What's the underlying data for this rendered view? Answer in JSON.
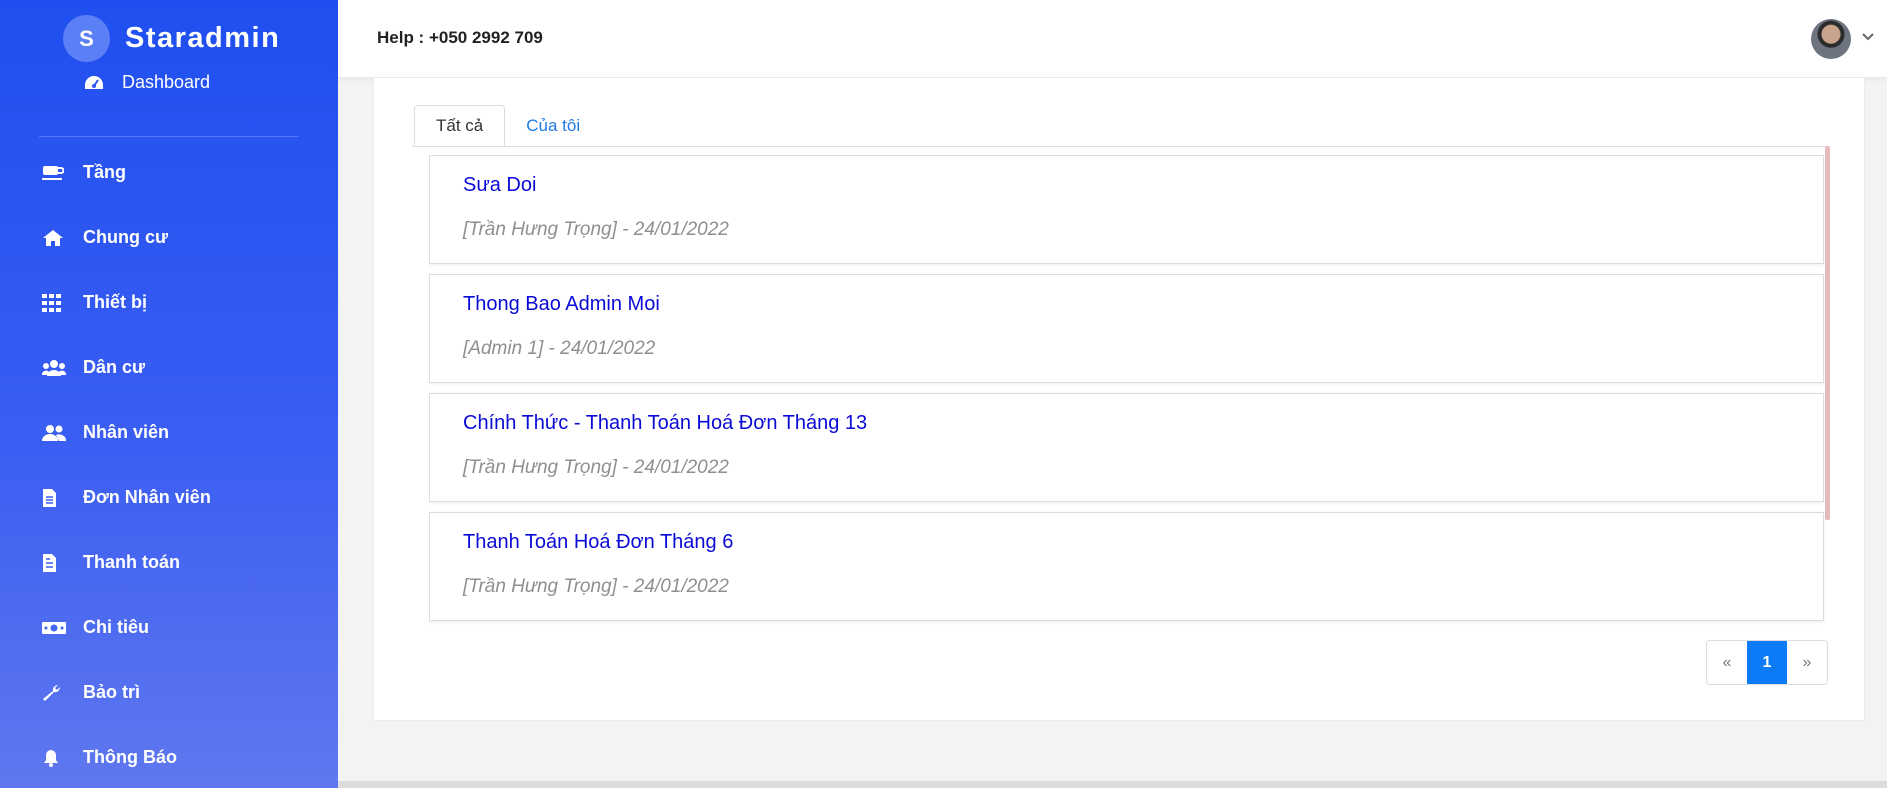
{
  "sidebar": {
    "brand_initial": "S",
    "brand_name": "Staradmin",
    "dashboard_label": "Dashboard",
    "items": [
      {
        "label": "Tầng",
        "icon": "coffee-cup-icon"
      },
      {
        "label": "Chung cư",
        "icon": "home-icon"
      },
      {
        "label": "Thiết bị",
        "icon": "grid-icon"
      },
      {
        "label": "Dân cư",
        "icon": "users-group-icon"
      },
      {
        "label": "Nhân viên",
        "icon": "user-friends-icon"
      },
      {
        "label": "Đơn Nhân viên",
        "icon": "file-icon"
      },
      {
        "label": "Thanh toán",
        "icon": "invoice-icon"
      },
      {
        "label": "Chi tiêu",
        "icon": "money-bill-icon"
      },
      {
        "label": "Bảo trì",
        "icon": "wrench-icon"
      },
      {
        "label": "Thông Báo",
        "icon": "bell-icon"
      }
    ]
  },
  "header": {
    "help_text": "Help : +050 2992 709"
  },
  "tabs": [
    {
      "label": "Tất cả",
      "active": true
    },
    {
      "label": "Của tôi",
      "active": false
    }
  ],
  "notifications": [
    {
      "title": "Sưa Doi",
      "meta": "[Trần Hưng Trọng] - 24/01/2022"
    },
    {
      "title": "Thong Bao Admin Moi",
      "meta": "[Admin 1] - 24/01/2022"
    },
    {
      "title": "Chính Thức - Thanh Toán Hoá Đơn Tháng 13",
      "meta": "[Trần Hưng Trọng] - 24/01/2022"
    },
    {
      "title": "Thanh Toán Hoá Đơn Tháng 6",
      "meta": "[Trần Hưng Trọng] - 24/01/2022"
    }
  ],
  "pagination": {
    "prev": "«",
    "current": "1",
    "next": "»"
  },
  "colors": {
    "sidebar_top": "#1f4ff0",
    "sidebar_bottom": "#5f78ef",
    "title_link": "#0a0ad6",
    "page_active": "#0d7bf5"
  }
}
